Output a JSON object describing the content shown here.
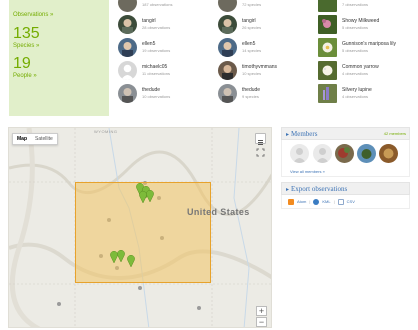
{
  "stats": {
    "observations_label": "Observations »",
    "species_count": "135",
    "species_label": "Species »",
    "people_count": "19",
    "people_label": "People »"
  },
  "leaderboards": {
    "observers": [
      {
        "name": "",
        "sub": "187 observations"
      },
      {
        "name": "tangirl",
        "sub": "28 observations"
      },
      {
        "name": "ellen5",
        "sub": "19 observations"
      },
      {
        "name": "michaelc05",
        "sub": "11 observations"
      },
      {
        "name": "thedude",
        "sub": "10 observations"
      }
    ],
    "species_observers": [
      {
        "name": "",
        "sub": "72 species"
      },
      {
        "name": "tangirl",
        "sub": "26 species"
      },
      {
        "name": "ellen5",
        "sub": "14 species"
      },
      {
        "name": "timothyvmmans",
        "sub": "10 species"
      },
      {
        "name": "thedude",
        "sub": "9 species"
      }
    ],
    "top_species": [
      {
        "name": "",
        "sub": "7 observations"
      },
      {
        "name": "Showy Milkweed",
        "sub": "5 observations"
      },
      {
        "name": "Gunnison's mariposa lily",
        "sub": "5 observations"
      },
      {
        "name": "Common yarrow",
        "sub": "4 observations"
      },
      {
        "name": "Silvery lupine",
        "sub": "4 observations"
      }
    ]
  },
  "map": {
    "type_map": "Map",
    "type_satellite": "Satellite",
    "country_label": "United States",
    "state_label": "WYOMING",
    "zoom_in": "+",
    "zoom_out": "−"
  },
  "members": {
    "title": "Members",
    "count": "42 members",
    "view_all": "View all members »"
  },
  "export": {
    "title": "Export observations",
    "atom": "Atom",
    "kml": "KML",
    "csv": "CSV",
    "sep": "|"
  },
  "colors": {
    "accent_green": "#74ac00",
    "stats_bg": "#e1efca",
    "link_blue": "#3d73b5",
    "bbox_fill": "#f2c464",
    "bbox_stroke": "#e7a22c"
  }
}
